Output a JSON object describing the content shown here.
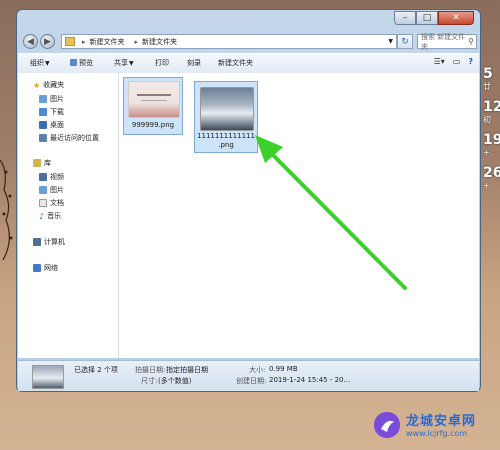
{
  "window": {
    "controls": {
      "minimize": "–",
      "maximize": "□",
      "close": "✕"
    }
  },
  "address_bar": {
    "back_icon": "back-arrow-icon",
    "forward_icon": "forward-arrow-icon",
    "breadcrumbs": [
      "新建文件夹",
      "新建文件夹"
    ],
    "search_placeholder": "搜索 新建文件夹",
    "refresh_glyph": "↻",
    "search_glyph": "⚲"
  },
  "toolbar": {
    "items": [
      "组织",
      "预览",
      "共享",
      "打印",
      "刻录",
      "新建文件夹"
    ]
  },
  "nav": {
    "favorites": {
      "label": "收藏夹",
      "items": [
        "图片",
        "下载",
        "桌面",
        "最近访问的位置"
      ]
    },
    "libraries": {
      "label": "库",
      "items": [
        "视频",
        "图片",
        "文档",
        "音乐"
      ]
    },
    "computer": "计算机",
    "network": "网络"
  },
  "files": [
    {
      "name": "999999.png",
      "selected": true
    },
    {
      "name_line1": "1111111111111",
      "name_line2": ".png",
      "selected": true
    }
  ],
  "status": {
    "selected": "已选择 2 个项",
    "date_taken_label": "拍摄日期:",
    "date_taken_value": "指定拍摄日期",
    "size_label": "大小:",
    "size_value": "0.99 MB",
    "dimensions_label": "尺寸:",
    "dimensions_value": "(多个数值)",
    "created_label": "创建日期:",
    "created_value": "2019-1-24 15:45 - 20..."
  },
  "desktop_widget": {
    "lines": [
      {
        "big": "5",
        "small": "廿"
      },
      {
        "big": "12",
        "small": "初"
      },
      {
        "big": "19",
        "small": "+"
      },
      {
        "big": "26",
        "small": "+"
      }
    ]
  },
  "watermark": {
    "title": "龙城安卓网",
    "url": "www.lcjrfg.com"
  },
  "colors": {
    "accent_arrow": "#3ad12a",
    "watermark": "#2a6ad6"
  }
}
